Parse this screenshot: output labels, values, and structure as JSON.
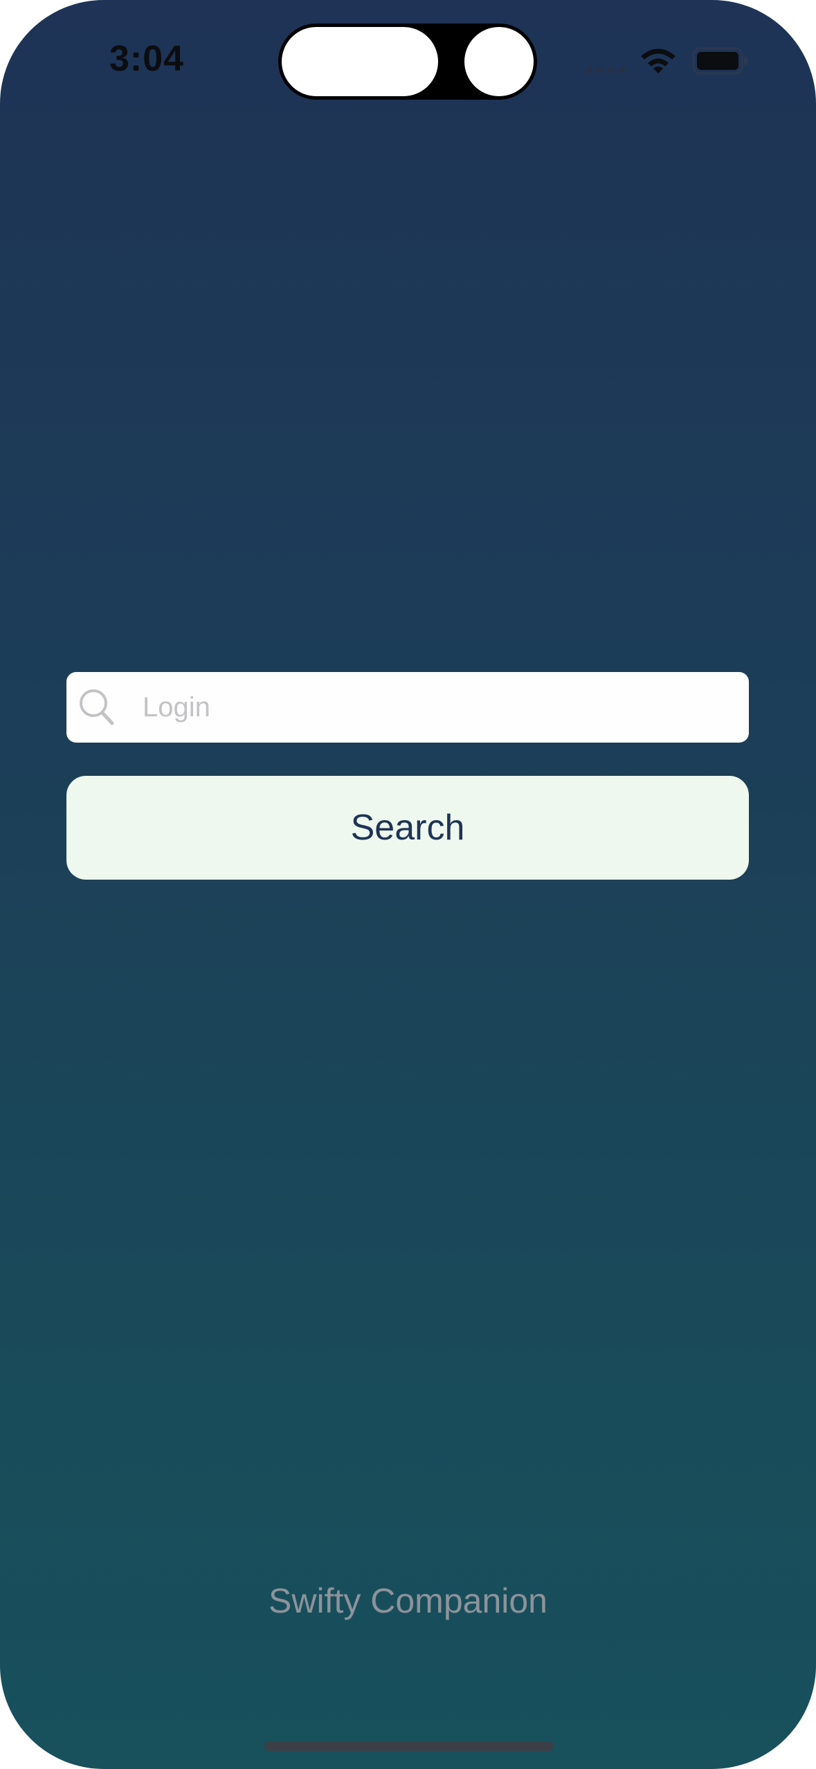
{
  "status_bar": {
    "time": "3:04",
    "icons": [
      "cellular-signal-icon",
      "wifi-icon",
      "battery-icon"
    ]
  },
  "login": {
    "placeholder": "Login",
    "value": "",
    "icon": "search-icon"
  },
  "search_button": {
    "label": "Search"
  },
  "footer": {
    "app_name": "Swifty Companion"
  },
  "colors": {
    "background_top": "#1e3356",
    "background_bottom": "#18505c",
    "button_background": "#eff8ee",
    "button_text": "#1e3356",
    "field_background": "#fefefe",
    "placeholder": "#c3c3c6",
    "app_name": "#8c939b"
  }
}
